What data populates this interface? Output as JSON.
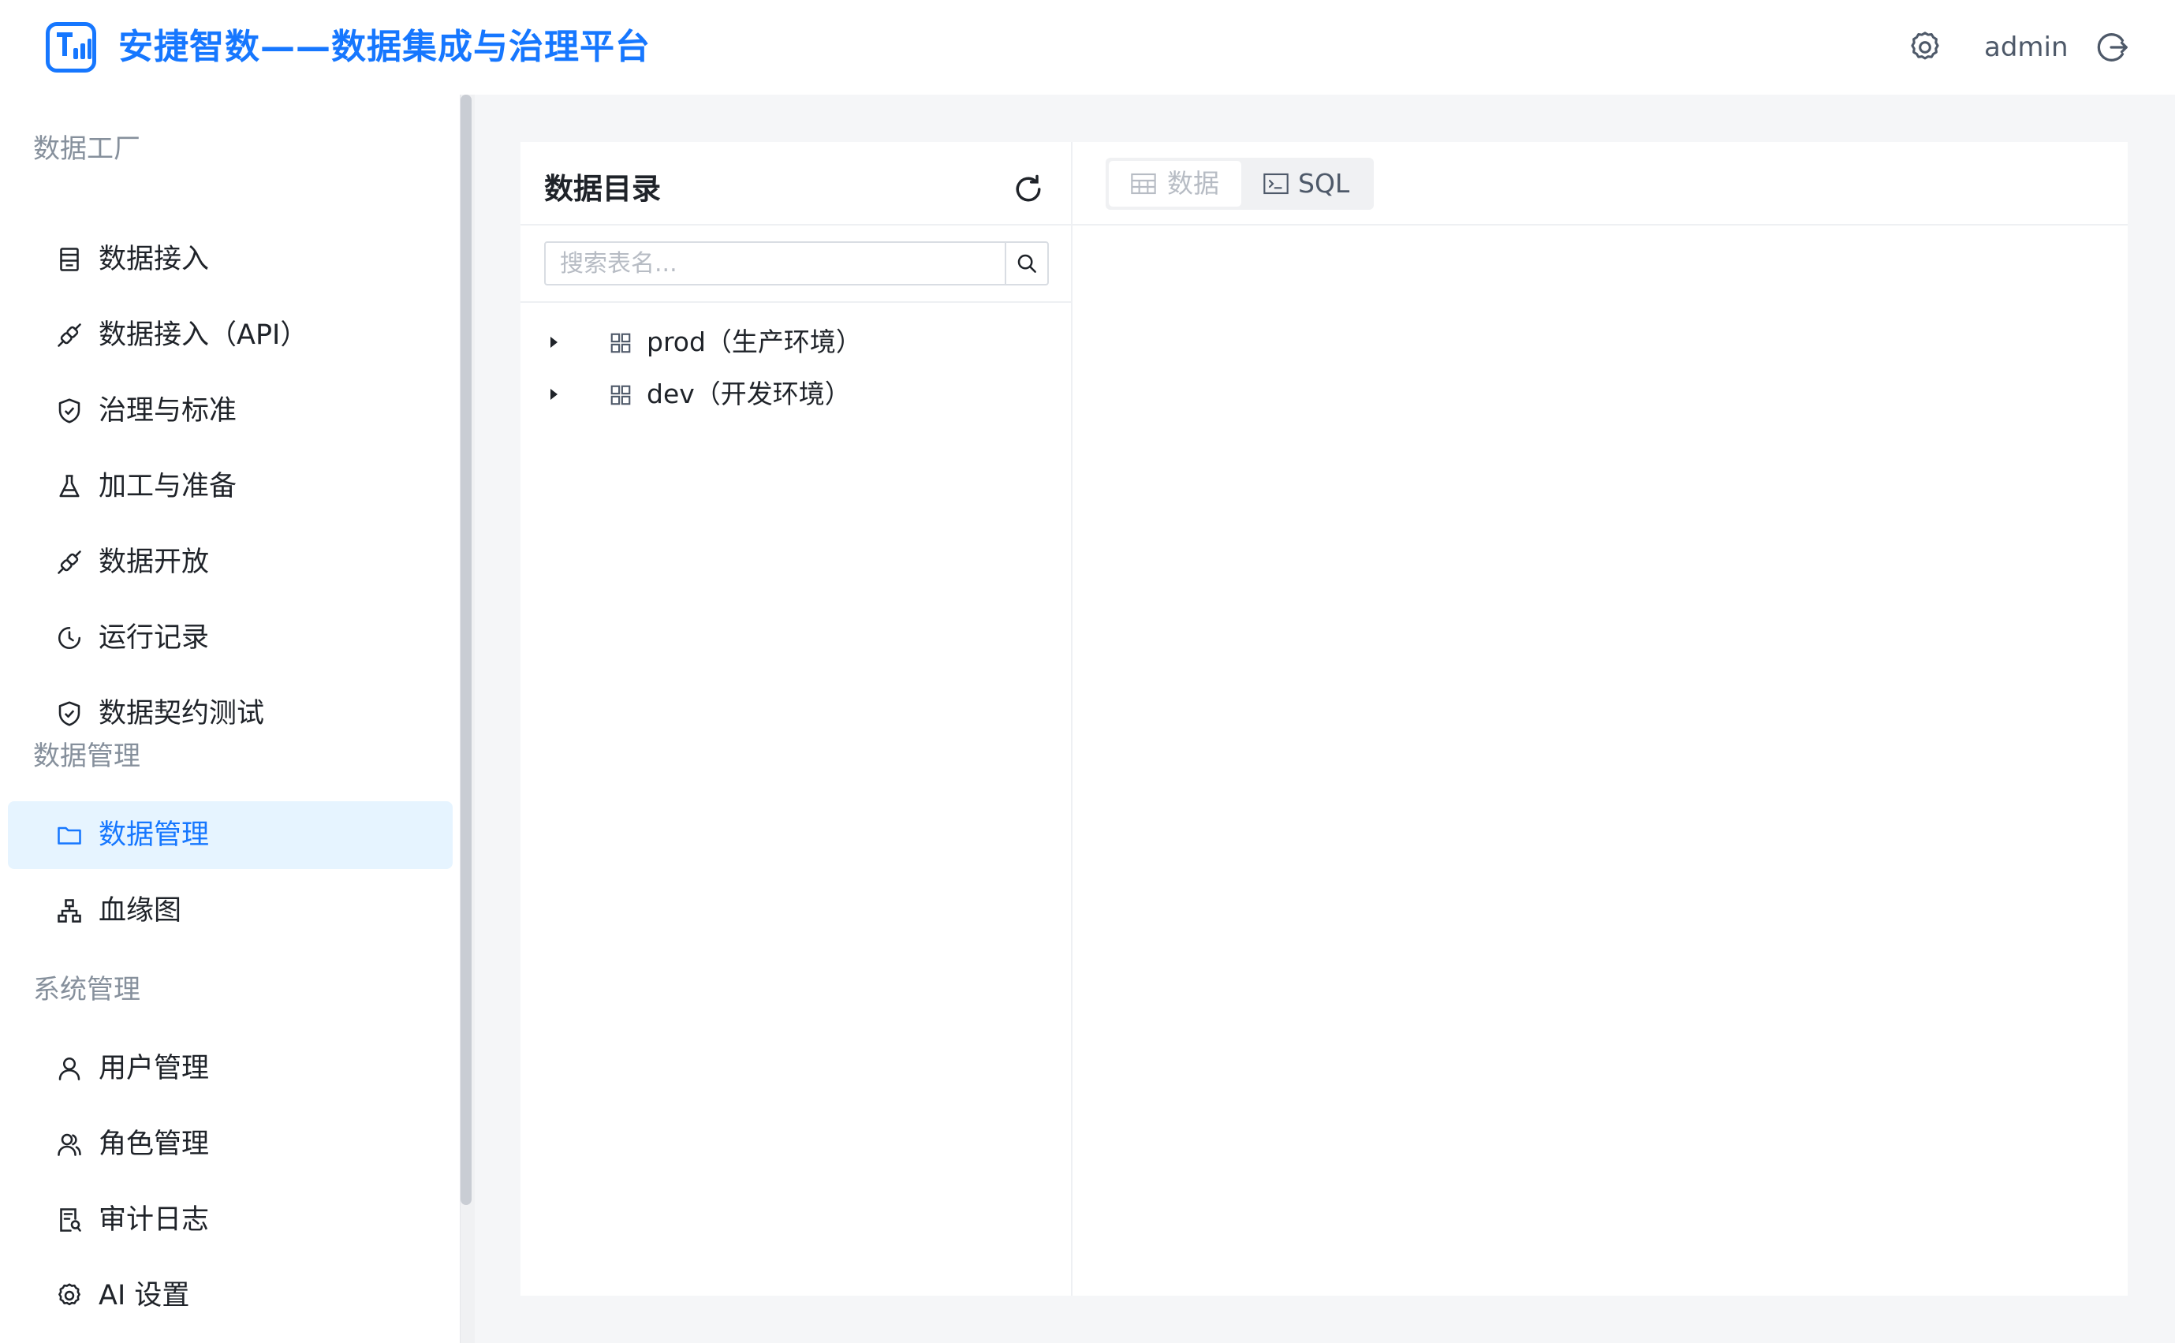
{
  "header": {
    "title": "安捷智数——数据集成与治理平台",
    "user": "admin",
    "accent_color": "#1677ff"
  },
  "sidebar": {
    "groups": [
      {
        "title": "数据工厂",
        "items": [
          {
            "label": "数据接入",
            "icon": "form-icon"
          },
          {
            "label": "数据接入（API）",
            "icon": "plug-icon"
          },
          {
            "label": "治理与标准",
            "icon": "shield-check-icon"
          },
          {
            "label": "加工与准备",
            "icon": "flask-icon"
          },
          {
            "label": "数据开放",
            "icon": "plug-icon"
          },
          {
            "label": "运行记录",
            "icon": "clock-icon"
          },
          {
            "label": "数据契约测试",
            "icon": "shield-check-icon"
          }
        ]
      },
      {
        "title": "数据管理",
        "items": [
          {
            "label": "数据管理",
            "icon": "folder-icon",
            "active": true
          },
          {
            "label": "血缘图",
            "icon": "hierarchy-icon"
          }
        ]
      },
      {
        "title": "系统管理",
        "items": [
          {
            "label": "用户管理",
            "icon": "user-icon"
          },
          {
            "label": "角色管理",
            "icon": "users-icon"
          },
          {
            "label": "审计日志",
            "icon": "audit-icon"
          },
          {
            "label": "AI 设置",
            "icon": "gear-icon"
          }
        ]
      }
    ]
  },
  "catalog": {
    "title": "数据目录",
    "search_placeholder": "搜索表名...",
    "nodes": [
      {
        "label": "prod（生产环境）",
        "icon": "database-grid-icon",
        "expanded": false
      },
      {
        "label": "dev（开发环境）",
        "icon": "database-grid-icon",
        "expanded": false
      }
    ]
  },
  "tabs": [
    {
      "label": "数据",
      "icon": "table-icon",
      "selected": false
    },
    {
      "label": "SQL",
      "icon": "terminal-icon",
      "selected": true
    }
  ]
}
